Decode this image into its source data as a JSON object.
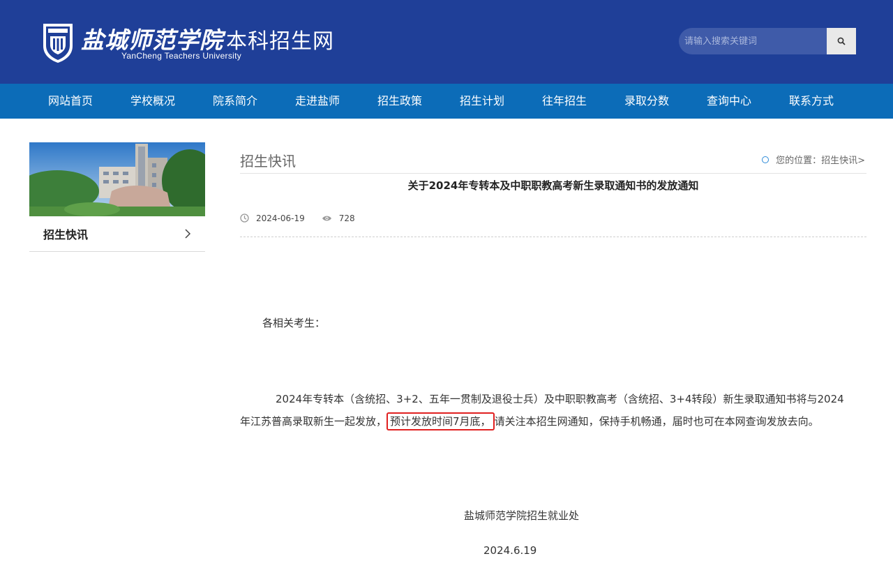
{
  "header": {
    "logo_cn": "盐城师范学院",
    "logo_site": "本科招生网",
    "logo_en": "YanCheng Teachers University",
    "search_placeholder": "请输入搜索关键词"
  },
  "nav": {
    "items": [
      "网站首页",
      "学校概况",
      "院系简介",
      "走进盐师",
      "招生政策",
      "招生计划",
      "往年招生",
      "录取分数",
      "查询中心",
      "联系方式"
    ]
  },
  "sidebar": {
    "item_label": "招生快讯"
  },
  "breadcrumb": {
    "prefix": "您的位置：",
    "current": "招生快讯>"
  },
  "article": {
    "section": "招生快讯",
    "title": "关于2024年专转本及中职职教高考新生录取通知书的发放通知",
    "date": "2024-06-19",
    "views": "728",
    "greeting": "各相关考生：",
    "para_before": "2024年专转本（含统招、3+2、五年一贯制及退役士兵）及中职职教高考（含统招、3+4转段）新生录取通知书将与2024年江苏普高录取新生一起发放，",
    "para_highlight": "预计发放时间7月底，",
    "para_after": "请关注本招生网通知，保持手机畅通，届时也可在本网查询发放去向。",
    "signature": "盐城师范学院招生就业处",
    "sign_date": "2024.6.19"
  },
  "colors": {
    "header_bg": "#1f3f98",
    "nav_bg": "#0c6cb8",
    "highlight_border": "#e02020"
  }
}
